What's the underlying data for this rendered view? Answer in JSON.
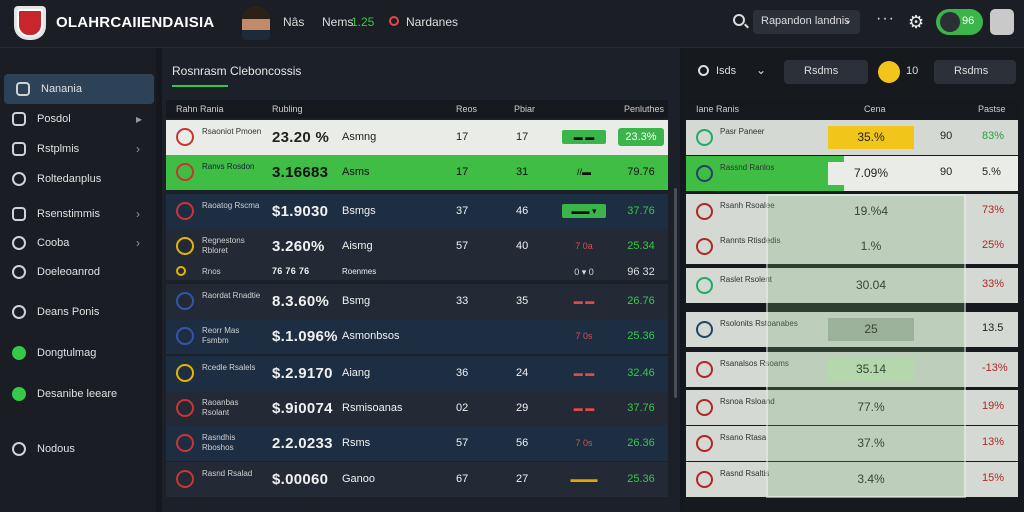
{
  "topbar": {
    "brand": "OLAHRCAIIENDAISIA",
    "user": "Nâs",
    "stat_label": "Nems",
    "stat_value": "1.25",
    "status": "Nardanes",
    "dropdown": "Rapandon landnis",
    "pill_value": "96",
    "colors": {
      "accent": "#35c94a",
      "alert": "#e04a4a"
    }
  },
  "sidebar": {
    "items": [
      {
        "label": "Nanania",
        "icon": "user-icon"
      },
      {
        "label": "Posdol",
        "icon": "box-icon"
      },
      {
        "label": "Rstplmis",
        "icon": "list-icon"
      },
      {
        "label": "Roltedanplus",
        "icon": "search-icon"
      },
      {
        "label": "Rsenstimmis",
        "icon": "arrow-icon"
      },
      {
        "label": "Cooba",
        "icon": "globe-icon"
      },
      {
        "label": "Doeleoanrod",
        "icon": "face-icon"
      },
      {
        "label": "Deans Ponis",
        "icon": "team-icon"
      },
      {
        "label": "Dongtulmag",
        "icon": "green-circle-icon"
      },
      {
        "label": "Desanibe leeare",
        "icon": "green-circle-icon"
      },
      {
        "label": "Nodous",
        "icon": "info-icon"
      }
    ]
  },
  "center": {
    "title": "Rosnrasm Cleboncossis",
    "headers": [
      "Rahn Rania",
      "Rubling",
      "Reos",
      "Pbiar",
      "Penluthes"
    ],
    "rows": [
      {
        "team": "Rsaoniot Pmoen",
        "pct": "23.20 %",
        "market": "Asmng",
        "c1": "17",
        "c2": "17",
        "flag": "▬ ▬",
        "val": "23.3%"
      },
      {
        "team": "Ranvs Rosdon",
        "pct": "3.16683",
        "market": "Asms",
        "c1": "17",
        "c2": "31",
        "flag": "//▬",
        "val": "79.76"
      },
      {
        "team": "Raoatog Rscma",
        "pct": "$1.9030",
        "market": "Bsmgs",
        "c1": "37",
        "c2": "46",
        "flag": "▬▬ ▾",
        "val": "37.76"
      },
      {
        "team": "Regnestons Rbloret",
        "pct": "3.260%",
        "market": "Aismg",
        "c1": "57",
        "c2": "40",
        "flag": "7 0a",
        "val": "25.34"
      },
      {
        "team": "Rnos",
        "pct": "76 76 76",
        "market": "Roenmes",
        "c1": "",
        "c2": "",
        "flag": "0 ▾ 0",
        "val": "96 32"
      },
      {
        "team": "Raordat Rnadtie",
        "pct": "8.3.60%",
        "market": "Bsmg",
        "c1": "33",
        "c2": "35",
        "flag": "▬ ▬",
        "val": "26.76"
      },
      {
        "team": "Reorr Mas Fsmbm",
        "pct": "$.1.096%",
        "market": "Asmonbsos",
        "c1": "",
        "c2": "",
        "flag": "7 0s",
        "val": "25.36"
      },
      {
        "team": "Rcedle Rsalels",
        "pct": "$.2.9170",
        "market": "Aiang",
        "c1": "36",
        "c2": "24",
        "flag": "▬ ▬",
        "val": "32.46"
      },
      {
        "team": "Raoanbas Rsolant",
        "pct": "$.9i0074",
        "market": "Rsmisoanas",
        "c1": "02",
        "c2": "29",
        "flag": "▬ ▬",
        "val": "37.76"
      },
      {
        "team": "Rasndhis Rboshos",
        "pct": "2.2.0233",
        "market": "Rsms",
        "c1": "57",
        "c2": "56",
        "flag": "7 0s",
        "val": "26.36"
      },
      {
        "team": "Rasnd Rsalad",
        "pct": "$.00060",
        "market": "Ganoo",
        "c1": "67",
        "c2": "27",
        "flag": "▬▬▬",
        "val": "25.36"
      }
    ]
  },
  "right": {
    "search_label": "Isds",
    "btn1": "Rsdms",
    "btn2_value": "10",
    "btn3": "Rsdms",
    "headers": [
      "Iane Ranis",
      "Cena",
      "Pastse"
    ],
    "rows": [
      {
        "team": "Pasr Paneer",
        "mid": "35.%",
        "c": "90",
        "p": "83%"
      },
      {
        "team": "Rassnd Ranlos",
        "mid": "7.09%",
        "c": "90",
        "p": "5.%"
      },
      {
        "team": "Rsanh Rsoalee",
        "mid": "19.%4",
        "c": "",
        "p": "73%"
      },
      {
        "team": "Rannts Rtisdedis",
        "mid": "1.%",
        "c": "",
        "p": "25%"
      },
      {
        "team": "Raslet Rsolent",
        "mid": "30.04",
        "c": "",
        "p": "33%"
      },
      {
        "team": "Rsolonits Rstoanabes",
        "mid": "25",
        "c": "",
        "p": "13.5"
      },
      {
        "team": "Rsanalsos Rsoams",
        "mid": "35.14",
        "c": "",
        "p": "-13%"
      },
      {
        "team": "Rsnoa Rsloand",
        "mid": "77.%",
        "c": "",
        "p": "19%"
      },
      {
        "team": "Rsano Rtasa",
        "mid": "37.%",
        "c": "",
        "p": "13%"
      },
      {
        "team": "Rasnd Rsaltis",
        "mid": "3.4%",
        "c": "",
        "p": "15%"
      }
    ]
  }
}
